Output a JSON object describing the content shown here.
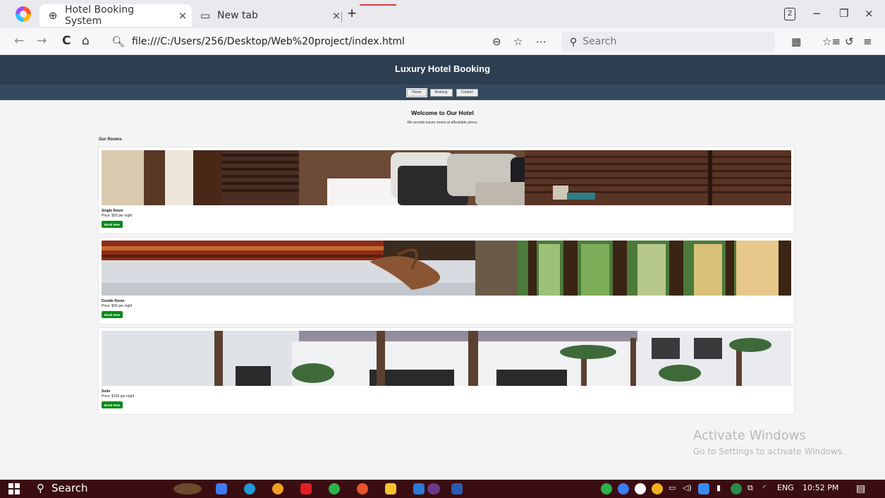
{
  "browser": {
    "tabs": [
      {
        "title": "Hotel Booking System",
        "icon": "globe-icon",
        "close": "×"
      },
      {
        "title": "New tab",
        "icon": "new-tab-page-icon",
        "close": "×"
      }
    ],
    "new_tab": "+",
    "tab_count": "2",
    "window_controls": {
      "minimize": "−",
      "restore": "❐",
      "close": "×"
    },
    "url": "file:///C:/Users/256/Desktop/Web%20project/index.html",
    "search_placeholder": "Search",
    "nav": {
      "back": "←",
      "forward": "→",
      "reload": "C",
      "home": "⌂"
    }
  },
  "site": {
    "title": "Luxury Hotel Booking",
    "nav": [
      "Home",
      "Booking",
      "Contact"
    ],
    "welcome_heading": "Welcome to Our Hotel",
    "welcome_text": "We provide luxury rooms at affordable prices.",
    "rooms_heading": "Our Rooms",
    "rooms": [
      {
        "name": "Single Room",
        "price": "Price: $50 per night",
        "button": "Book Now"
      },
      {
        "name": "Double Room",
        "price": "Price: $90 per night",
        "button": "Book Now"
      },
      {
        "name": "Suite",
        "price": "Price: $150 per night",
        "button": "Book Now"
      }
    ]
  },
  "watermark": {
    "title": "Activate Windows",
    "subtitle": "Go to Settings to activate Windows."
  },
  "taskbar": {
    "search": "Search",
    "lang": "ENG",
    "time": "10:52 PM"
  },
  "colors": {
    "header": "#2c3e50",
    "subnav": "#34495e",
    "book_button": "#0a8a1a",
    "taskbar": "#3a0d12"
  }
}
